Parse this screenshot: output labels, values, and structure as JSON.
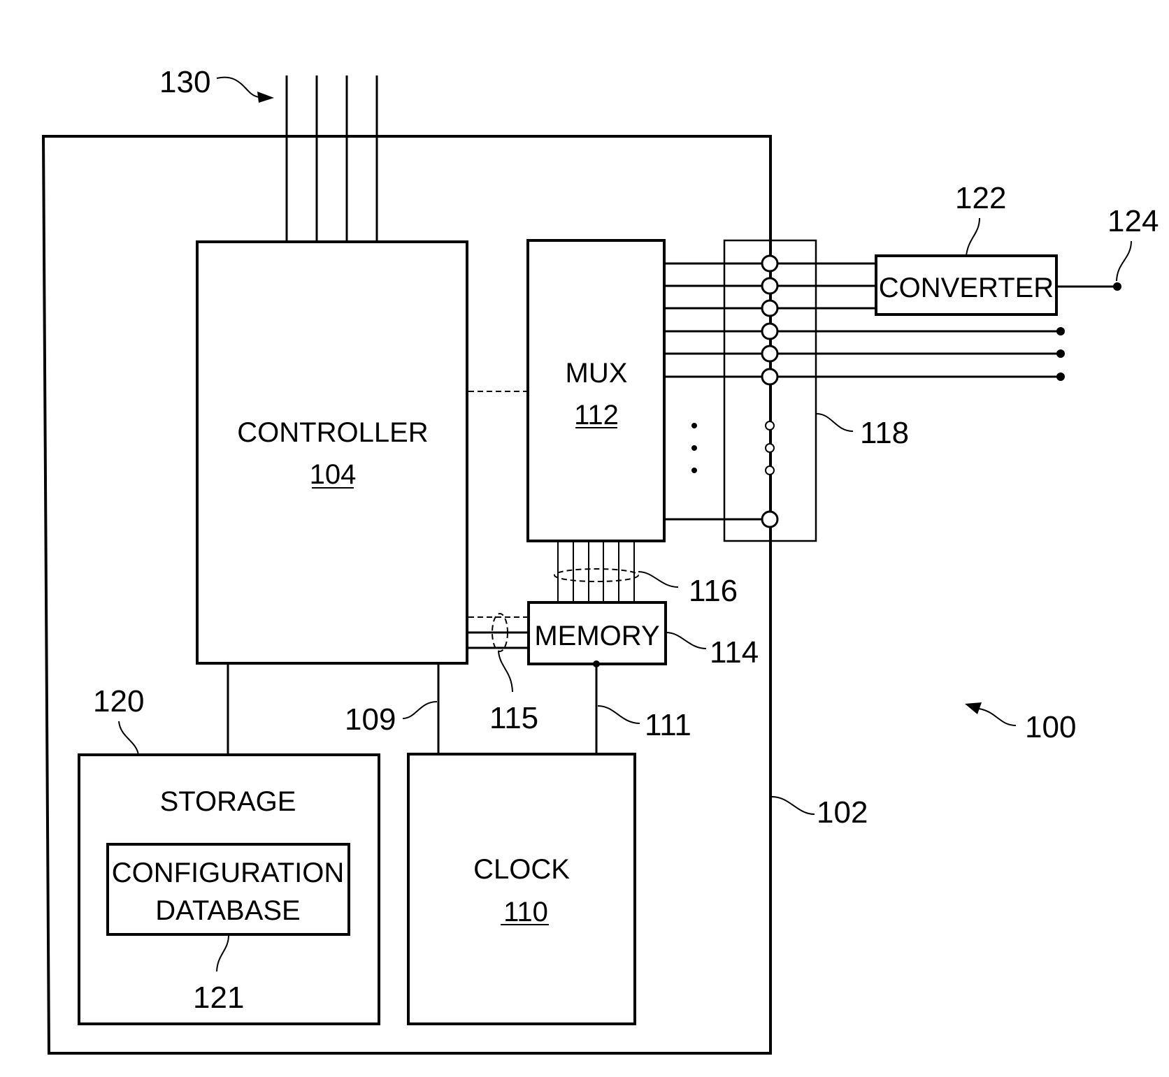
{
  "figure": {
    "system_ref": "100",
    "enclosure_ref": "102",
    "bus_ref": "130",
    "controller": {
      "title": "CONTROLLER",
      "ref": "104"
    },
    "mux": {
      "title": "MUX",
      "ref": "112"
    },
    "memory": {
      "title": "MEMORY",
      "ref": "114"
    },
    "clock": {
      "title": "CLOCK",
      "ref": "110"
    },
    "storage": {
      "title": "STORAGE",
      "ref": "120"
    },
    "config_db": {
      "line1": "CONFIGURATION",
      "line2": "DATABASE",
      "ref": "121"
    },
    "converter": {
      "title": "CONVERTER",
      "ref": "122"
    },
    "output_ref": "124",
    "port_panel_ref": "118",
    "mux_memory_bus_ref": "116",
    "controller_memory_bus_ref": "115",
    "controller_clock_line_ref": "109",
    "memory_clock_line_ref": "111"
  }
}
